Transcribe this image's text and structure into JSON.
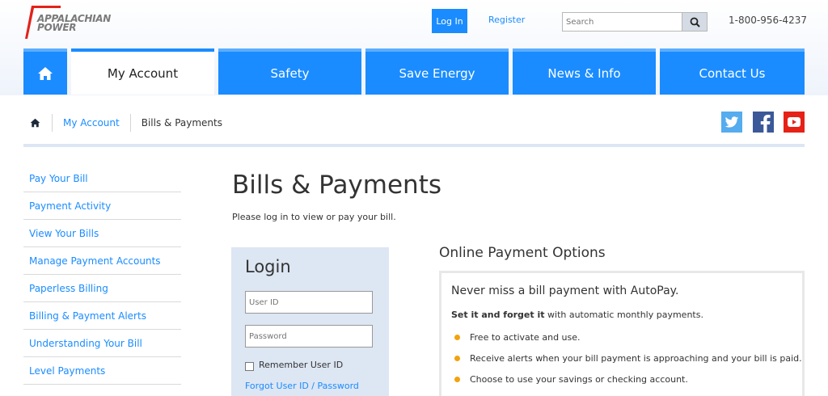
{
  "brand": {
    "line1": "APPALACHIAN",
    "line2": "POWER"
  },
  "header": {
    "login_label": "Log In",
    "register_label": "Register",
    "search_placeholder": "Search",
    "phone": "1-800-956-4237",
    "accent_color": "#1a8cff"
  },
  "nav": {
    "items": [
      {
        "label": "My Account",
        "active": true
      },
      {
        "label": "Safety"
      },
      {
        "label": "Save Energy"
      },
      {
        "label": "News & Info"
      },
      {
        "label": "Contact Us"
      }
    ]
  },
  "breadcrumb": {
    "items": [
      "My Account",
      "Bills & Payments"
    ]
  },
  "social": [
    "twitter-icon",
    "facebook-icon",
    "youtube-icon"
  ],
  "sidebar": {
    "items": [
      "Pay Your Bill",
      "Payment Activity",
      "View Your Bills",
      "Manage Payment Accounts",
      "Paperless Billing",
      "Billing & Payment Alerts",
      "Understanding Your Bill",
      "Level Payments"
    ]
  },
  "main": {
    "title": "Bills & Payments",
    "intro": "Please log in to view or pay your bill."
  },
  "login": {
    "title": "Login",
    "user_placeholder": "User ID",
    "password_placeholder": "Password",
    "remember_label": "Remember User ID",
    "forgot_label": "Forgot User ID / Password"
  },
  "options": {
    "title": "Online Payment Options",
    "headline": "Never miss a bill payment with AutoPay.",
    "sub_bold": "Set it and forget it",
    "sub_rest": " with automatic monthly payments.",
    "bullets": [
      "Free to activate and use.",
      "Receive alerts when your bill payment is approaching and your bill is paid.",
      "Choose to use your savings or checking account."
    ],
    "bullet_color": "#f2a20c"
  }
}
